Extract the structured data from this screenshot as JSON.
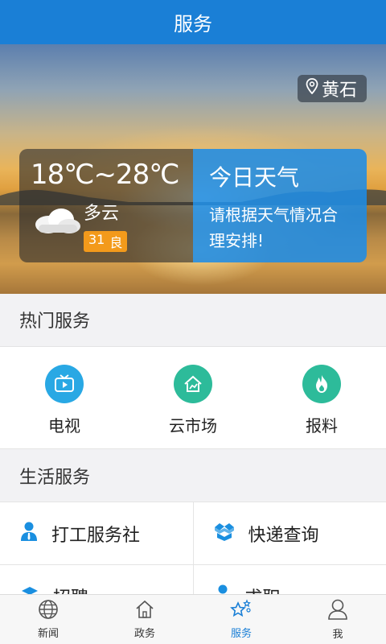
{
  "header": {
    "title": "服务"
  },
  "location": {
    "city": "黄石"
  },
  "weather": {
    "temp_range": "18℃~28℃",
    "condition": "多云",
    "aqi_value": "31",
    "aqi_level": "良",
    "panel_title": "今日天气",
    "panel_text": "请根据天气情况合理安排!"
  },
  "hot_services": {
    "title": "热门服务",
    "items": [
      {
        "label": "电视",
        "icon": "tv-icon",
        "color": "#29a8e4"
      },
      {
        "label": "云市场",
        "icon": "market-icon",
        "color": "#2dbb9a"
      },
      {
        "label": "报料",
        "icon": "flame-icon",
        "color": "#2dbb9a"
      }
    ]
  },
  "life_services": {
    "title": "生活服务",
    "items": [
      {
        "label": "打工服务社",
        "icon": "worker-icon"
      },
      {
        "label": "快递查询",
        "icon": "box-icon"
      },
      {
        "label": "招聘",
        "icon": "recruit-icon"
      },
      {
        "label": "求职",
        "icon": "jobseek-icon"
      }
    ]
  },
  "tabbar": {
    "items": [
      {
        "label": "新闻",
        "icon": "globe-icon"
      },
      {
        "label": "政务",
        "icon": "building-icon"
      },
      {
        "label": "服务",
        "icon": "stars-icon"
      },
      {
        "label": "我",
        "icon": "user-icon"
      }
    ],
    "active": "服务"
  },
  "colors": {
    "primary": "#1a7fd6",
    "aqi_badge": "#f39a1b"
  }
}
